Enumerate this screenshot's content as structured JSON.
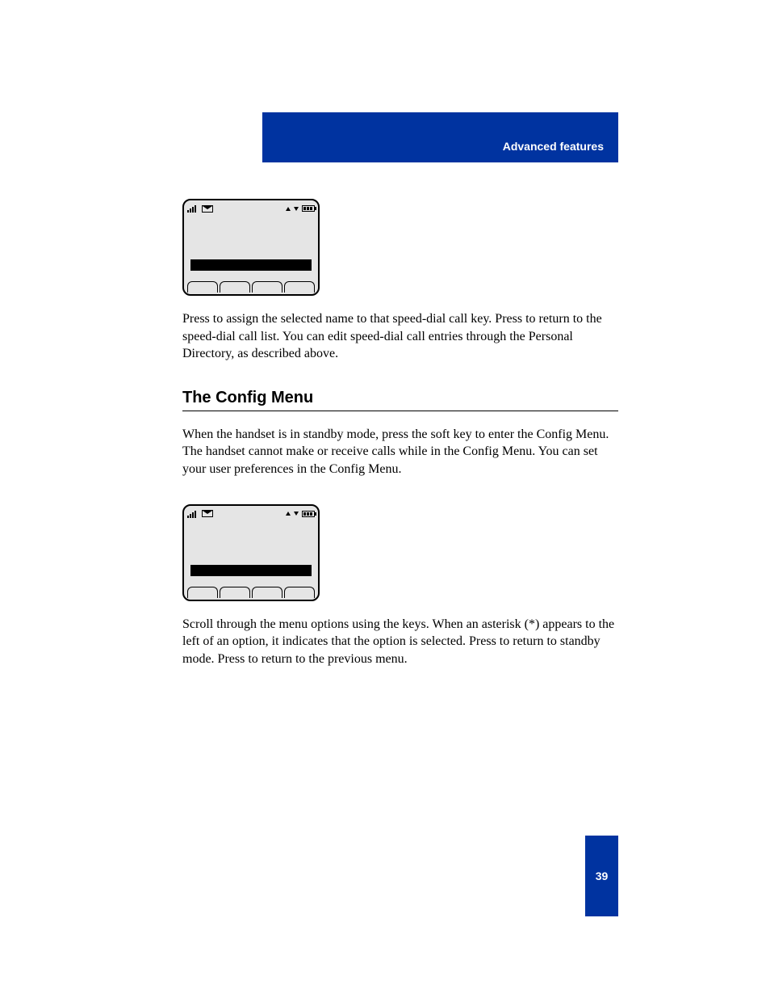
{
  "header": {
    "title": "Advanced features"
  },
  "para1": "Press            to assign the selected name to that speed-dial call key. Press            to return to the speed-dial call list. You can edit speed-dial call entries through the Personal Directory, as described above.",
  "section_heading": "The Config Menu",
  "para2": "When the handset is in standby mode, press  the          soft key to enter the Config Menu. The handset cannot make or receive calls while in the Config Menu. You can set your user preferences in the Config Menu.",
  "para3": "Scroll through the menu options using the          keys. When an asterisk (*) appears to the left of an option, it indicates that the option is selected. Press           to return to standby mode. Press             to return to the previous menu.",
  "page_number": "39"
}
